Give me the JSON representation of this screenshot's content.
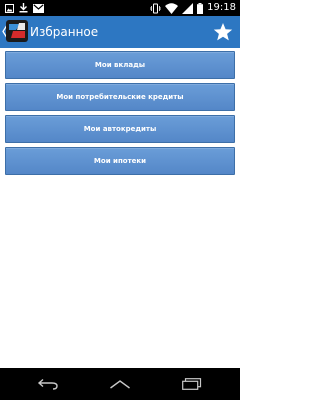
{
  "status_bar": {
    "time": "19:18",
    "icons": [
      "image-notification-icon",
      "download-notification-icon",
      "gmail-notification-icon",
      "vibrate-icon",
      "wifi-icon",
      "signal-icon",
      "battery-icon"
    ]
  },
  "action_bar": {
    "title": "Избранное",
    "icons": [
      "up-caret-icon",
      "app-logo-icon",
      "star-icon"
    ],
    "color": "#2d77c2"
  },
  "menu": {
    "items": [
      {
        "label": "Мои вклады"
      },
      {
        "label": "Мои потребительские кредиты"
      },
      {
        "label": "Мои автокредиты"
      },
      {
        "label": "Мои ипотеки"
      }
    ],
    "button_color": "#5a8dcf"
  },
  "nav_bar": {
    "icons": [
      "back-icon",
      "home-icon",
      "recents-icon"
    ]
  }
}
